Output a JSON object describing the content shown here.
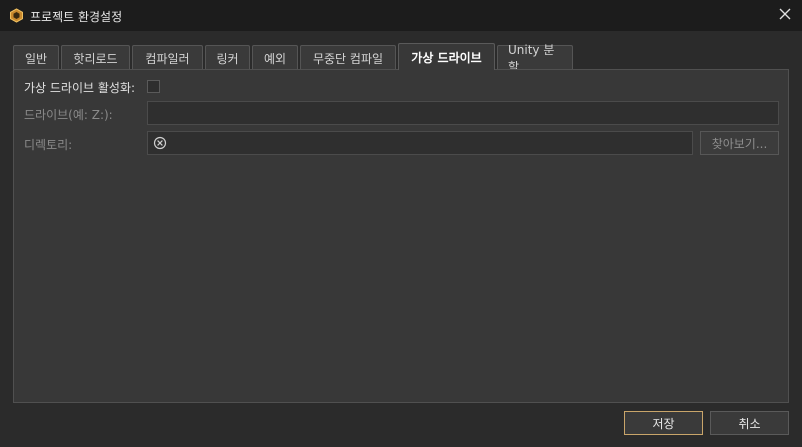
{
  "window": {
    "title": "프로젝트 환경설정",
    "app_icon": "hexagon-app-icon",
    "close_icon": "close-icon"
  },
  "tabs": [
    {
      "label": "일반",
      "active": false
    },
    {
      "label": "핫리로드",
      "active": false
    },
    {
      "label": "컴파일러",
      "active": false
    },
    {
      "label": "링커",
      "active": false
    },
    {
      "label": "예외",
      "active": false
    },
    {
      "label": "무중단 컴파일",
      "active": false
    },
    {
      "label": "가상 드라이브",
      "active": true
    },
    {
      "label": "Unity 분할",
      "active": false
    }
  ],
  "virtual_drive": {
    "enable_label": "가상 드라이브 활성화:",
    "enabled": false,
    "drive_label": "드라이브(예: Z:):",
    "drive_value": "",
    "directory_label": "디렉토리:",
    "directory_value": "",
    "browse_label": "찾아보기..."
  },
  "footer": {
    "save_label": "저장",
    "cancel_label": "취소"
  },
  "colors": {
    "accent": "#c9a56a",
    "background": "#2b2b2b",
    "panel": "#383838"
  }
}
